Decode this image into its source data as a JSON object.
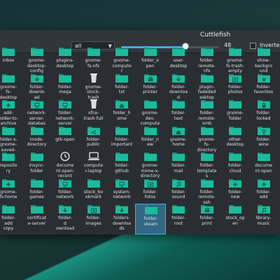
{
  "window": {
    "title": "Cuttlefish",
    "filter_value": "all",
    "icon_size": "48",
    "icon_size_fraction": 0.66,
    "inverted_label": "Inverte"
  },
  "colors": {
    "folder": "#1abc9c",
    "folder_dark": "#14967c",
    "glyph": "#0d5e4e",
    "selection": "#3daee9"
  },
  "icons": [
    {
      "label": "inbox",
      "icon": "folder-icon",
      "glyph": "none"
    },
    {
      "label": "gnome-\ndesktop-\nconfig",
      "icon": "folder-icon",
      "glyph": "none"
    },
    {
      "label": "plugins-\ndesktop",
      "icon": "folder-icon",
      "glyph": "none"
    },
    {
      "label": "gnome-\nfs-nfs",
      "icon": "folder-icon",
      "glyph": "none"
    },
    {
      "label": "gnome-\ncompute\nr",
      "icon": "folder-icon",
      "glyph": "none"
    },
    {
      "label": "folder_o\npen",
      "icon": "folder-icon",
      "glyph": "none"
    },
    {
      "label": "user-\ndesktop",
      "icon": "folder-icon",
      "glyph": "none"
    },
    {
      "label": "folder-\nremote-\nnfs",
      "icon": "folder-icon",
      "glyph": "none"
    },
    {
      "label": "gnome-\nfs-trash-\nempty",
      "icon": "folder-icon",
      "glyph": "none"
    },
    {
      "label": "show-\nbackgro\nund",
      "icon": "folder-icon",
      "glyph": "none"
    },
    {
      "label": "gnome-\nfs-\ndesktop",
      "icon": "folder-icon",
      "glyph": "none"
    },
    {
      "label": "folder-\ndownlo\nad",
      "icon": "folder-download-icon",
      "glyph": "arrow"
    },
    {
      "label": "folder-\nmega",
      "icon": "folder-icon",
      "glyph": "none"
    },
    {
      "label": "gnome-\nstock-\ntrash",
      "icon": "trash-icon",
      "glyph": "none"
    },
    {
      "label": "folder-\ntxt",
      "icon": "folder-icon",
      "glyph": "none"
    },
    {
      "label": "folder-\nprinter",
      "icon": "folder-printer-icon",
      "glyph": "printer"
    },
    {
      "label": "folder-\ndownloa\nd",
      "icon": "folder-download-icon",
      "glyph": "arrow"
    },
    {
      "label": "plugin-\nfadeded\nesktop",
      "icon": "folder-icon",
      "glyph": "none"
    },
    {
      "label": "folder-\nphotos",
      "icon": "folder-photos-icon",
      "glyph": "photo"
    },
    {
      "label": "folder-\nfavorites",
      "icon": "folder-favorites-icon",
      "glyph": "star"
    },
    {
      "label": "add-\nfolder-to-\narchive",
      "icon": "folder-add-icon",
      "glyph": "plus"
    },
    {
      "label": "network-\nserver-\ndatabas",
      "icon": "folder-network-icon",
      "glyph": "network"
    },
    {
      "label": "folder-\nnetwork-\nserver",
      "icon": "folder-network-icon",
      "glyph": "network"
    },
    {
      "label": "xfce-\ntrash-full",
      "icon": "trash-icon",
      "glyph": "none"
    },
    {
      "label": "folder_h\nome",
      "icon": "folder-home-icon",
      "glyph": "home"
    },
    {
      "label": "gnome-\ndev-\ncompute",
      "icon": "folder-icon",
      "glyph": "none"
    },
    {
      "label": "folder-\ntext",
      "icon": "folder-icon",
      "glyph": "none"
    },
    {
      "label": "folder-\nremote-\nsmb",
      "icon": "folder-icon",
      "glyph": "none"
    },
    {
      "label": "gnome-\nfolder",
      "icon": "folder-icon",
      "glyph": "none"
    },
    {
      "label": "folder-\nlocked",
      "icon": "folder-locked-icon",
      "glyph": "lock"
    },
    {
      "label": "folder-x-\ngnome-\nsaved-",
      "icon": "folder-icon",
      "glyph": "none"
    },
    {
      "label": "inode-\ndirectory",
      "icon": "folder-icon",
      "glyph": "none"
    },
    {
      "label": "gtk-open",
      "icon": "folder-open-icon",
      "glyph": "none"
    },
    {
      "label": "folder-\npublic",
      "icon": "folder-public-icon",
      "glyph": "share"
    },
    {
      "label": "folder-\nimportant",
      "icon": "folder-important-icon",
      "glyph": "none"
    },
    {
      "label": "folder_n\new",
      "icon": "folder-new-icon",
      "glyph": "none"
    },
    {
      "label": "gnome-\nhome",
      "icon": "folder-home-icon",
      "glyph": "home"
    },
    {
      "label": "gnome-\nfs-\ndirectory",
      "icon": "folder-icon",
      "glyph": "none"
    },
    {
      "label": "other-\ndesktop",
      "icon": "folder-icon",
      "glyph": "none"
    },
    {
      "label": "folder-\nwine",
      "icon": "folder-wine-icon",
      "glyph": "glass"
    },
    {
      "label": "reposito\nry",
      "icon": "folder-icon",
      "glyph": "none"
    },
    {
      "label": "insync-\nfolder",
      "icon": "folder-icon",
      "glyph": "none"
    },
    {
      "label": "docume\nnt-open-\nrecent",
      "icon": "clock-icon",
      "glyph": "none"
    },
    {
      "label": "compute\nr-laptop",
      "icon": "laptop-icon",
      "glyph": "none"
    },
    {
      "label": "folder-\ngithub",
      "icon": "folder-github-icon",
      "glyph": "none"
    },
    {
      "label": "gnome-\nmime-x-\ndirectory",
      "icon": "folder-icon",
      "glyph": "none"
    },
    {
      "label": "folder-\nmail",
      "icon": "folder-mail-icon",
      "glyph": "none"
    },
    {
      "label": "folder-\ntemplate\ns",
      "icon": "folder-templates-icon",
      "glyph": "none"
    },
    {
      "label": "folder-\ncloud",
      "icon": "folder-cloud-icon",
      "glyph": "none"
    },
    {
      "label": "docume\nnt-open",
      "icon": "folder-open-icon",
      "glyph": "none"
    },
    {
      "label": "gnome-\nfs-home",
      "icon": "folder-home-icon",
      "glyph": "plus"
    },
    {
      "label": "folder-\ngames",
      "icon": "folder-games-icon",
      "glyph": "none"
    },
    {
      "label": "folder-\nnetwork",
      "icon": "folder-network-icon",
      "glyph": "network"
    },
    {
      "label": "stock_bo\nokmark",
      "icon": "folder-bookmark-icon",
      "glyph": "none"
    },
    {
      "label": "system-\nnetwork",
      "icon": "folder-network-icon",
      "glyph": "network"
    },
    {
      "label": "folder-\nfotos",
      "icon": "folder-photos-icon",
      "glyph": "photo"
    },
    {
      "label": "folder-\nsound",
      "icon": "folder-sound-icon",
      "glyph": "music"
    },
    {
      "label": "folder-\nremote-\nssh",
      "icon": "folder-icon",
      "glyph": "none"
    },
    {
      "label": "folder-\nnew",
      "icon": "folder-new-icon",
      "glyph": "plus"
    },
    {
      "label": "folder-\nadd",
      "icon": "folder-add-icon",
      "glyph": "plus"
    },
    {
      "label": "folder-\nadd\ncopy",
      "icon": "folder-icon",
      "glyph": "none"
    },
    {
      "label": "certificat\ne-server",
      "icon": "folder-icon",
      "glyph": "none"
    },
    {
      "label": "folder-\nd\nownload",
      "icon": "folder-download-icon",
      "glyph": "arrow"
    },
    {
      "label": "folder-\nimages",
      "icon": "folder-photos-icon",
      "glyph": "photo"
    },
    {
      "label": "folders-\ndownloa\nds",
      "icon": "folder-download-icon",
      "glyph": "arrow"
    },
    {
      "label": "folder-\nsteam",
      "icon": "folder-steam-icon",
      "glyph": "none",
      "selected": true
    },
    {
      "label": "folder-\nroot",
      "icon": "folder-icon",
      "glyph": "none"
    },
    {
      "label": "folder-\nprint",
      "icon": "folder-printer-icon",
      "glyph": "printer"
    },
    {
      "label": "stock_op\nen",
      "icon": "folder-open-icon",
      "glyph": "none"
    },
    {
      "label": "library-\nmusic",
      "icon": "folder-sound-icon",
      "glyph": "music"
    }
  ]
}
